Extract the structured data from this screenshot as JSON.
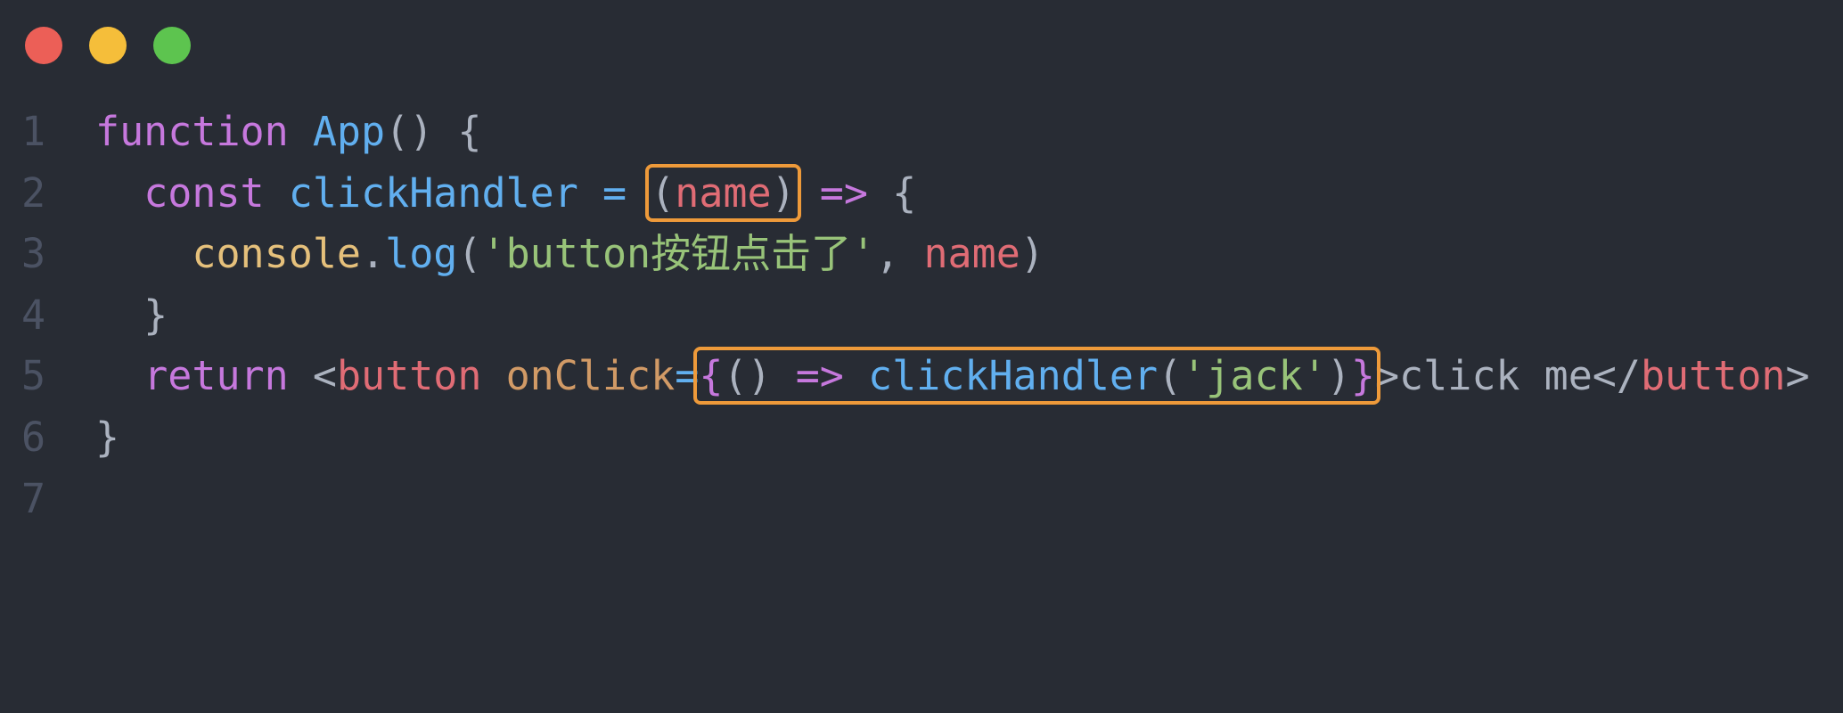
{
  "window": {
    "traffic_lights": [
      {
        "name": "close",
        "color": "#ec5f57"
      },
      {
        "name": "minimize",
        "color": "#f5be3a"
      },
      {
        "name": "maximize",
        "color": "#5dc44f"
      }
    ]
  },
  "colors": {
    "background": "#282c34",
    "highlight_box": "#ee9a3a",
    "keyword": "#c678dd",
    "function": "#61afef",
    "string": "#98c379",
    "variable": "#e06c75",
    "attribute": "#d19a66",
    "object": "#e5c07b",
    "line_number": "#4b5263"
  },
  "editor": {
    "lines": [
      {
        "num": "1",
        "tokens": {
          "t1": "function",
          "t2": " ",
          "t3": "App",
          "t4": "() {"
        }
      },
      {
        "num": "2",
        "tokens": {
          "t1": "  ",
          "t2": "const",
          "t3": " ",
          "t4": "clickHandler",
          "t5": " ",
          "t6": "=",
          "t7": " ",
          "t8": "(",
          "t9": "name",
          "t10": ")",
          "t11": " ",
          "t12": "=>",
          "t13": " {"
        }
      },
      {
        "num": "3",
        "tokens": {
          "t1": "    ",
          "t2": "console",
          "t3": ".",
          "t4": "log",
          "t5": "(",
          "t6": "'button按钮点击了'",
          "t7": ", ",
          "t8": "name",
          "t9": ")"
        }
      },
      {
        "num": "4",
        "tokens": {
          "t1": "  }"
        }
      },
      {
        "num": "5",
        "tokens": {
          "t1": "  ",
          "t2": "return",
          "t3": " ",
          "t4": "<",
          "t5": "button",
          "t6": " ",
          "t7": "onClick",
          "t8": "=",
          "t9": "{",
          "t10": "()",
          "t11": " ",
          "t12": "=>",
          "t13": " ",
          "t14": "clickHandler",
          "t15": "(",
          "t16": "'jack'",
          "t17": ")",
          "t18": "}",
          "t19": ">click me</",
          "t20": "button",
          "t21": ">"
        }
      },
      {
        "num": "6",
        "tokens": {
          "t1": "}"
        }
      },
      {
        "num": "7",
        "tokens": {}
      }
    ]
  }
}
